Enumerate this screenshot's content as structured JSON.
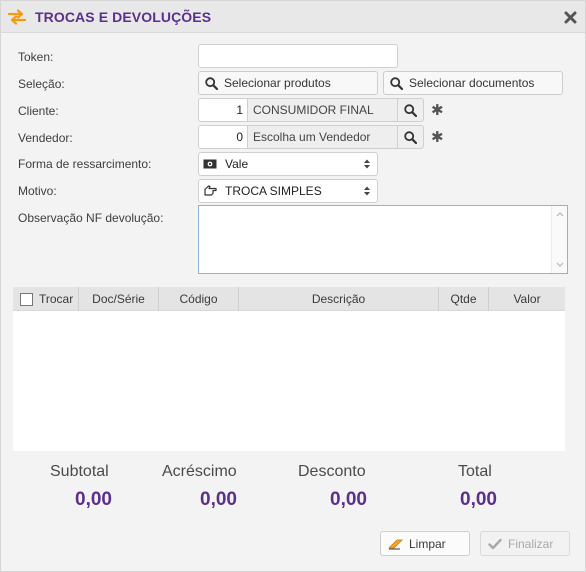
{
  "window": {
    "title": "TROCAS E DEVOLUÇÕES"
  },
  "form": {
    "token_label": "Token:",
    "token_value": "",
    "selecao_label": "Seleção:",
    "select_products_label": "Selecionar produtos",
    "select_documents_label": "Selecionar documentos",
    "cliente_label": "Cliente:",
    "cliente_code": "1",
    "cliente_name": "CONSUMIDOR FINAL",
    "vendedor_label": "Vendedor:",
    "vendedor_code": "0",
    "vendedor_name": "Escolha um Vendedor",
    "required_mark": "✱",
    "ressarcimento_label": "Forma de ressarcimento:",
    "ressarcimento_value": "Vale",
    "motivo_label": "Motivo:",
    "motivo_value": "TROCA SIMPLES",
    "observacao_label": "Observação NF devolução:",
    "observacao_value": ""
  },
  "table": {
    "columns": [
      "Trocar",
      "Doc/Série",
      "Código",
      "Descrição",
      "Qtde",
      "Valor"
    ],
    "rows": []
  },
  "totals": {
    "subtotal_label": "Subtotal",
    "subtotal_value": "0,00",
    "acrescimo_label": "Acréscimo",
    "acrescimo_value": "0,00",
    "desconto_label": "Desconto",
    "desconto_value": "0,00",
    "total_label": "Total",
    "total_value": "0,00"
  },
  "footer": {
    "limpar_label": "Limpar",
    "finalizar_label": "Finalizar"
  },
  "colors": {
    "accent_purple": "#5b2f8c",
    "accent_orange": "#f39c12"
  },
  "icons": [
    "swap-arrows-icon",
    "close-icon",
    "search-icon",
    "money-icon",
    "hand-pointer-icon",
    "eraser-icon",
    "check-icon"
  ]
}
